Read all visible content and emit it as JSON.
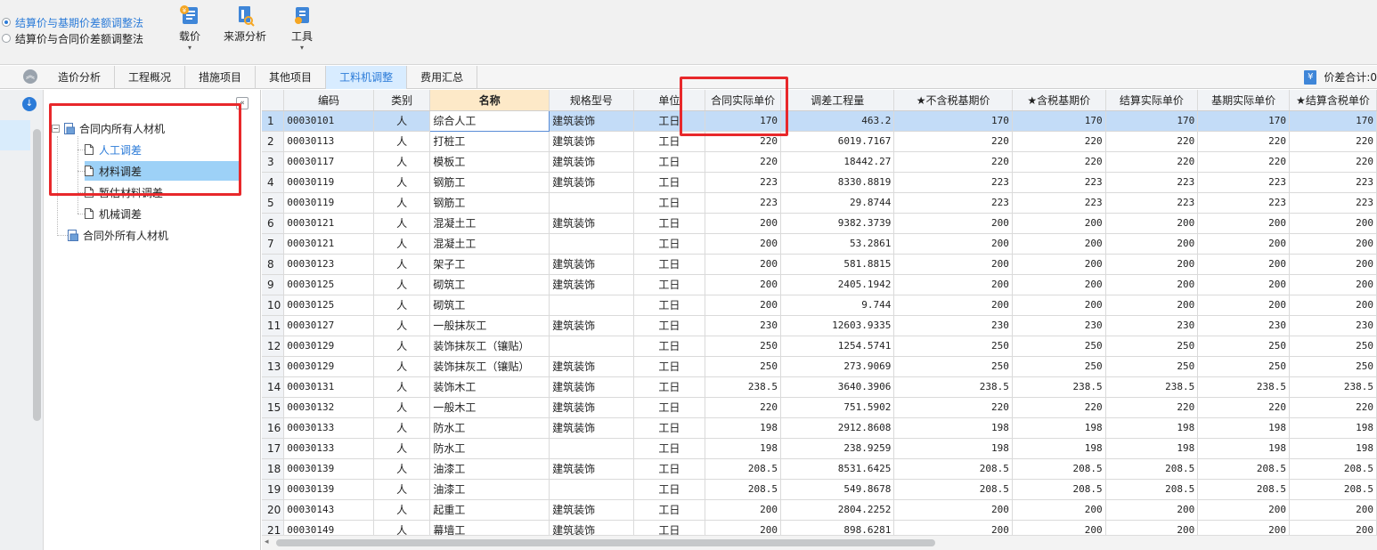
{
  "toolbar": {
    "radios": [
      {
        "label": "结算价与基期价差额调整法",
        "checked": true
      },
      {
        "label": "结算价与合同价差额调整法",
        "checked": false
      }
    ],
    "tools": [
      {
        "label": "载价",
        "icon": "price-load-icon",
        "has_dropdown": true
      },
      {
        "label": "来源分析",
        "icon": "source-analysis-icon",
        "has_dropdown": false
      },
      {
        "label": "工具",
        "icon": "tools-icon",
        "has_dropdown": true
      }
    ]
  },
  "tabs": [
    {
      "label": "造价分析",
      "active": false
    },
    {
      "label": "工程概况",
      "active": false
    },
    {
      "label": "措施项目",
      "active": false
    },
    {
      "label": "其他项目",
      "active": false
    },
    {
      "label": "工料机调整",
      "active": true
    },
    {
      "label": "费用汇总",
      "active": false
    }
  ],
  "price_total": {
    "label": "价差合计:0"
  },
  "tree": {
    "root1": "合同内所有人材机",
    "children": [
      "人工调差",
      "材料调差",
      "暂估材料调差",
      "机械调差"
    ],
    "root2": "合同外所有人材机"
  },
  "grid": {
    "columns": [
      "",
      "编码",
      "类别",
      "名称",
      "规格型号",
      "单位",
      "合同实际单价",
      "调差工程量",
      "★不含税基期价",
      "★含税基期价",
      "结算实际单价",
      "基期实际单价",
      "★结算含税单价"
    ],
    "rows": [
      [
        "1",
        "00030101",
        "人",
        "综合人工",
        "建筑装饰",
        "工日",
        "170",
        "463.2",
        "170",
        "170",
        "170",
        "170",
        "170"
      ],
      [
        "2",
        "00030113",
        "人",
        "打桩工",
        "建筑装饰",
        "工日",
        "220",
        "6019.7167",
        "220",
        "220",
        "220",
        "220",
        "220"
      ],
      [
        "3",
        "00030117",
        "人",
        "模板工",
        "建筑装饰",
        "工日",
        "220",
        "18442.27",
        "220",
        "220",
        "220",
        "220",
        "220"
      ],
      [
        "4",
        "00030119",
        "人",
        "钢筋工",
        "建筑装饰",
        "工日",
        "223",
        "8330.8819",
        "223",
        "223",
        "223",
        "223",
        "223"
      ],
      [
        "5",
        "00030119",
        "人",
        "钢筋工",
        "",
        "工日",
        "223",
        "29.8744",
        "223",
        "223",
        "223",
        "223",
        "223"
      ],
      [
        "6",
        "00030121",
        "人",
        "混凝土工",
        "建筑装饰",
        "工日",
        "200",
        "9382.3739",
        "200",
        "200",
        "200",
        "200",
        "200"
      ],
      [
        "7",
        "00030121",
        "人",
        "混凝土工",
        "",
        "工日",
        "200",
        "53.2861",
        "200",
        "200",
        "200",
        "200",
        "200"
      ],
      [
        "8",
        "00030123",
        "人",
        "架子工",
        "建筑装饰",
        "工日",
        "200",
        "581.8815",
        "200",
        "200",
        "200",
        "200",
        "200"
      ],
      [
        "9",
        "00030125",
        "人",
        "砌筑工",
        "建筑装饰",
        "工日",
        "200",
        "2405.1942",
        "200",
        "200",
        "200",
        "200",
        "200"
      ],
      [
        "10",
        "00030125",
        "人",
        "砌筑工",
        "",
        "工日",
        "200",
        "9.744",
        "200",
        "200",
        "200",
        "200",
        "200"
      ],
      [
        "11",
        "00030127",
        "人",
        "一般抹灰工",
        "建筑装饰",
        "工日",
        "230",
        "12603.9335",
        "230",
        "230",
        "230",
        "230",
        "230"
      ],
      [
        "12",
        "00030129",
        "人",
        "装饰抹灰工（镶贴）",
        "",
        "工日",
        "250",
        "1254.5741",
        "250",
        "250",
        "250",
        "250",
        "250"
      ],
      [
        "13",
        "00030129",
        "人",
        "装饰抹灰工（镶贴）",
        "建筑装饰",
        "工日",
        "250",
        "273.9069",
        "250",
        "250",
        "250",
        "250",
        "250"
      ],
      [
        "14",
        "00030131",
        "人",
        "装饰木工",
        "建筑装饰",
        "工日",
        "238.5",
        "3640.3906",
        "238.5",
        "238.5",
        "238.5",
        "238.5",
        "238.5"
      ],
      [
        "15",
        "00030132",
        "人",
        "一般木工",
        "建筑装饰",
        "工日",
        "220",
        "751.5902",
        "220",
        "220",
        "220",
        "220",
        "220"
      ],
      [
        "16",
        "00030133",
        "人",
        "防水工",
        "建筑装饰",
        "工日",
        "198",
        "2912.8608",
        "198",
        "198",
        "198",
        "198",
        "198"
      ],
      [
        "17",
        "00030133",
        "人",
        "防水工",
        "",
        "工日",
        "198",
        "238.9259",
        "198",
        "198",
        "198",
        "198",
        "198"
      ],
      [
        "18",
        "00030139",
        "人",
        "油漆工",
        "建筑装饰",
        "工日",
        "208.5",
        "8531.6425",
        "208.5",
        "208.5",
        "208.5",
        "208.5",
        "208.5"
      ],
      [
        "19",
        "00030139",
        "人",
        "油漆工",
        "",
        "工日",
        "208.5",
        "549.8678",
        "208.5",
        "208.5",
        "208.5",
        "208.5",
        "208.5"
      ],
      [
        "20",
        "00030143",
        "人",
        "起重工",
        "建筑装饰",
        "工日",
        "200",
        "2804.2252",
        "200",
        "200",
        "200",
        "200",
        "200"
      ],
      [
        "21",
        "00030149",
        "人",
        "幕墙工",
        "建筑装饰",
        "工日",
        "200",
        "898.6281",
        "200",
        "200",
        "200",
        "200",
        "200"
      ]
    ]
  },
  "colors": {
    "accent": "#2b7bd8",
    "highlight_box": "#e8282b",
    "selected_row": "#c3dcf7",
    "name_header": "#fde9c8"
  }
}
